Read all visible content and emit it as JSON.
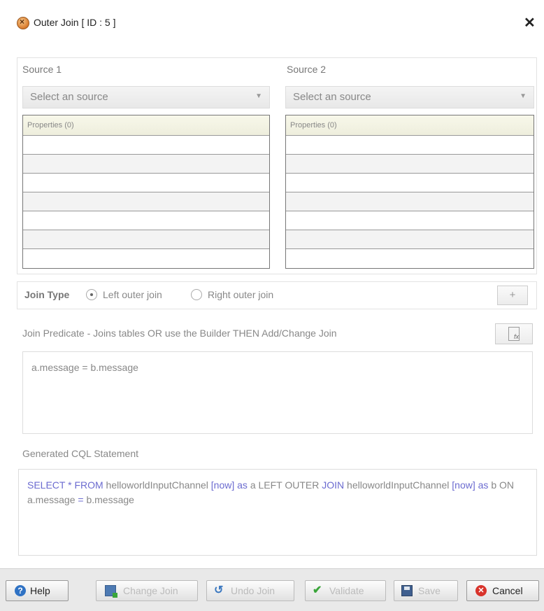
{
  "window": {
    "title": "Outer Join [ ID : 5 ]",
    "close_glyph": "✕"
  },
  "source1": {
    "label": "Source 1",
    "placeholder": "Select an source",
    "grid_header": "Properties (0)"
  },
  "source2": {
    "label": "Source 2",
    "placeholder": "Select an source",
    "grid_header": "Properties (0)"
  },
  "join_type": {
    "label": "Join Type",
    "options": [
      "Left outer join",
      "Right outer join"
    ],
    "selected": "Left outer join",
    "add_glyph": "+"
  },
  "predicate": {
    "label": "Join Predicate - Joins tables OR use the Builder THEN Add/Change Join",
    "value": "a.message  =  b.message"
  },
  "generated": {
    "label": "Generated CQL Statement",
    "tokens": {
      "select": "SELECT",
      "star": " * ",
      "from": "FROM",
      "ch1": "  helloworldInputChannel ",
      "now1": "[now]",
      "as1": " as ",
      "a_left_outer": "a LEFT OUTER ",
      "join": "JOIN",
      "ch2": "  helloworldInputChannel ",
      "now2": "[now]",
      "as2": " as ",
      "rest": "b ON a.message  ",
      "eq": "=",
      "tail": "  b.message"
    }
  },
  "footer": {
    "help": "Help",
    "change_join": "Change Join",
    "undo_join": "Undo Join",
    "validate": "Validate",
    "save": "Save",
    "cancel": "Cancel"
  },
  "colors": {
    "keyword": "#6b6bd0",
    "disabled_text": "#bbbbbb",
    "footer_bg": "#e9e9e9"
  }
}
